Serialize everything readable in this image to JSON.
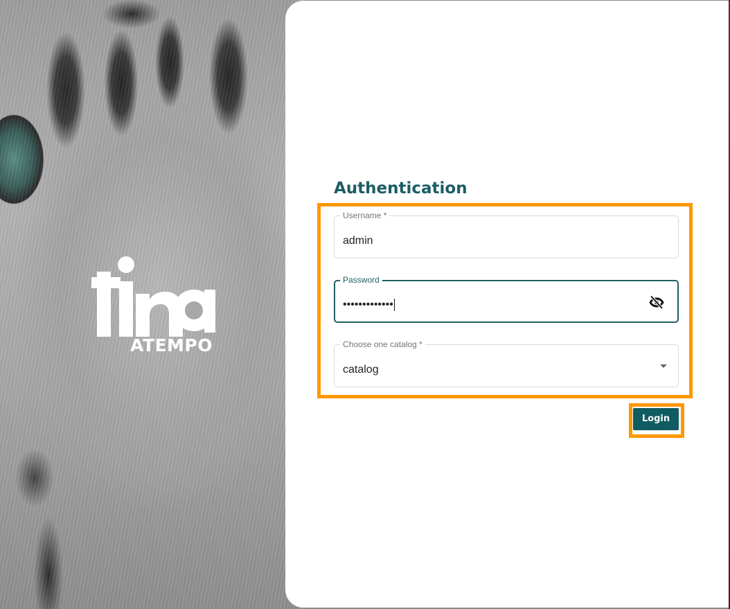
{
  "branding": {
    "logo_text": "tina",
    "company": "ATEMPO"
  },
  "auth": {
    "title": "Authentication",
    "username": {
      "label": "Username *",
      "value": "admin"
    },
    "password": {
      "label": "Password",
      "masked_value": "•••••••••••••",
      "toggle_icon": "eye-off-icon"
    },
    "catalog": {
      "label": "Choose one catalog *",
      "value": "catalog",
      "dropdown_icon": "caret-down-icon"
    },
    "login_label": "Login"
  },
  "colors": {
    "accent": "#0f5c62",
    "title": "#1b5d63",
    "highlight": "#ff9800"
  }
}
